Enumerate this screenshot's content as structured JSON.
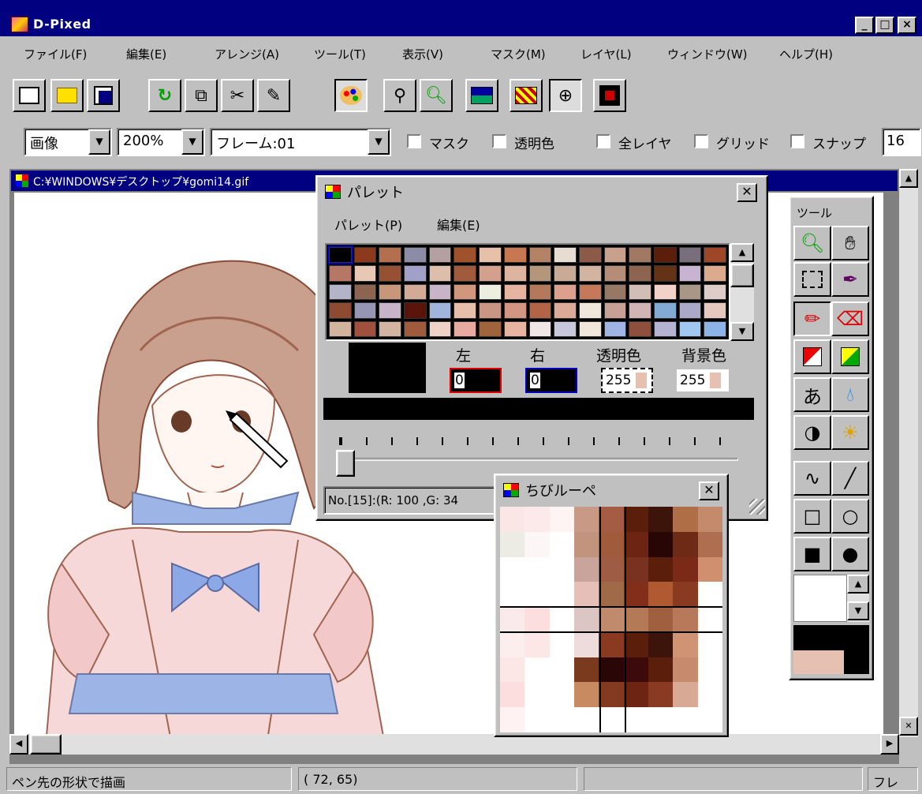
{
  "window": {
    "title": "D-Pixed",
    "minimize": "_",
    "maximize": "□",
    "close": "×"
  },
  "menubar": [
    "ファイル(F)",
    "編集(E)",
    "アレンジ(A)",
    "ツール(T)",
    "表示(V)",
    "マスク(M)",
    "レイヤ(L)",
    "ウィンドウ(W)",
    "ヘルプ(H)"
  ],
  "toolbar": {
    "icons": [
      "new-icon",
      "open-folder-icon",
      "save-icon",
      "undo-icon",
      "copy-icon",
      "cut-icon",
      "paste-icon",
      "palette-icon",
      "dropper-icon",
      "zoom-icon",
      "image-icon",
      "pattern-icon",
      "crosshair-icon",
      "film-icon"
    ]
  },
  "options": {
    "mode": "画像",
    "zoom": "200%",
    "frame": "フレーム:01",
    "mask_label": "マスク",
    "transparent_label": "透明色",
    "all_layers_label": "全レイヤ",
    "grid_label": "グリッド",
    "snap_label": "スナップ",
    "snap_value": "16"
  },
  "document": {
    "title": "C:¥WINDOWS¥デスクトップ¥gomi14.gif"
  },
  "palette": {
    "title": "パレット",
    "menu": [
      "パレット(P)",
      "編集(E)"
    ],
    "left_label": "左",
    "right_label": "右",
    "transparent_label": "透明色",
    "background_label": "背景色",
    "left_value": "0",
    "right_value": "0",
    "transparent_value": "255",
    "background_value": "255",
    "info": "No.[15]:(R: 100 ,G: 34",
    "colors": [
      "#000000",
      "#8b3a1e",
      "#b4704e",
      "#8c8ca6",
      "#b4a0a0",
      "#a0522d",
      "#e6c0a8",
      "#c87850",
      "#b48264",
      "#e6dcd2",
      "#8c5a46",
      "#c8a08c",
      "#a07864",
      "#5a1e0a",
      "#786e7c",
      "#a04628",
      "#b47864",
      "#e6c8b4",
      "#965032",
      "#a0a0c8",
      "#dcbeaa",
      "#a05a3c",
      "#d2a08c",
      "#dcb4a0",
      "#b4967d",
      "#c8aa96",
      "#d2b4a0",
      "#b48c78",
      "#8c6450",
      "#643214",
      "#c8b4d2",
      "#dcaa8c",
      "#b4b4c8",
      "#8c6450",
      "#c89678",
      "#d2aa96",
      "#c8b4c8",
      "#d2967d",
      "#eeeee0",
      "#e6b4a0",
      "#b4785a",
      "#dca08c",
      "#c8785a",
      "#967864",
      "#d2beb4",
      "#f0d2c8",
      "#aa9687",
      "#dccdc8",
      "#8c4b32",
      "#9696b4",
      "#c8b4c8",
      "#5a140a",
      "#a0b4dc",
      "#e6beaa",
      "#c89682",
      "#d29682",
      "#b46446",
      "#dcaa96",
      "#f0e6dc",
      "#c8a096",
      "#d2b4b4",
      "#82aad2",
      "#aaaac8",
      "#e6c8be",
      "#d2b49c",
      "#a0503c",
      "#d2b4a0",
      "#a05a3c",
      "#eed2c8",
      "#e6aaa0",
      "#a0643c",
      "#e6b4a0",
      "#f0e6e6",
      "#c8c8dc",
      "#f0e6dc",
      "#a0b4e6",
      "#8c503c",
      "#b4b4d2",
      "#a0c8f0",
      "#8cb4e6"
    ]
  },
  "loupe": {
    "title": "ちびルーペ",
    "cells": [
      "#fbe6e6",
      "#fceaea",
      "#fff4f4",
      "#c89a86",
      "#a45c44",
      "#5a1e0a",
      "#3c140a",
      "#b06e46",
      "#c48a6c",
      "#ecece4",
      "#fdf6f6",
      "#ffffff",
      "#c2947e",
      "#a05a3c",
      "#6e2412",
      "#280606",
      "#6e2a14",
      "#b06e50",
      "#ffffff",
      "#ffffff",
      "#ffffff",
      "#c8a49c",
      "#9e5c44",
      "#7a3220",
      "#5a1e0a",
      "#7a2a16",
      "#d09070",
      "#ffffff",
      "#ffffff",
      "#ffffff",
      "#e6c0b8",
      "#a06a48",
      "#822e1a",
      "#b05a32",
      "#8a3a20",
      "#ffffff",
      "#fbeaea",
      "#fcdede",
      "#ffffff",
      "#dcc6c4",
      "#c08a6c",
      "#b47a58",
      "#a06040",
      "#b8785a",
      "#ffffff",
      "#fdeeee",
      "#fde6e6",
      "#ffffff",
      "#eedcdc",
      "#8a3a20",
      "#5a1e0a",
      "#3c140a",
      "#d09474",
      "#ffffff",
      "#fde6e6",
      "#ffffff",
      "#ffffff",
      "#7a3a1e",
      "#2a0606",
      "#3c0a0a",
      "#5a1e0a",
      "#c88a6c",
      "#ffffff",
      "#fcdede",
      "#ffffff",
      "#ffffff",
      "#c88a60",
      "#843a20",
      "#6e2412",
      "#8a3a22",
      "#d8aa96",
      "#ffffff",
      "#fff2f2",
      "#ffffff",
      "#ffffff",
      "#ffffff",
      "#ffffff",
      "#ffffff",
      "#ffffff",
      "#ffffff",
      "#ffffff"
    ]
  },
  "tools": {
    "title": "ツール",
    "items": [
      "zoom-icon",
      "hand-icon",
      "select-rect-icon",
      "dropper-icon",
      "pencil-icon",
      "eraser-icon",
      "copy-rect-icon",
      "fill-region-icon",
      "text-icon",
      "spray-icon",
      "contrast-icon",
      "brightness-icon",
      "curve-icon",
      "line-icon",
      "rect-icon",
      "ellipse-icon",
      "filled-rect-icon",
      "filled-ellipse-icon"
    ],
    "text_char": "あ",
    "fg_color": "#000000",
    "bg_color": "#e6c0b0"
  },
  "status": {
    "message": "ペン先の形状で描画",
    "coords": "(  72,   65)",
    "extra": "",
    "frame": "フレ"
  }
}
